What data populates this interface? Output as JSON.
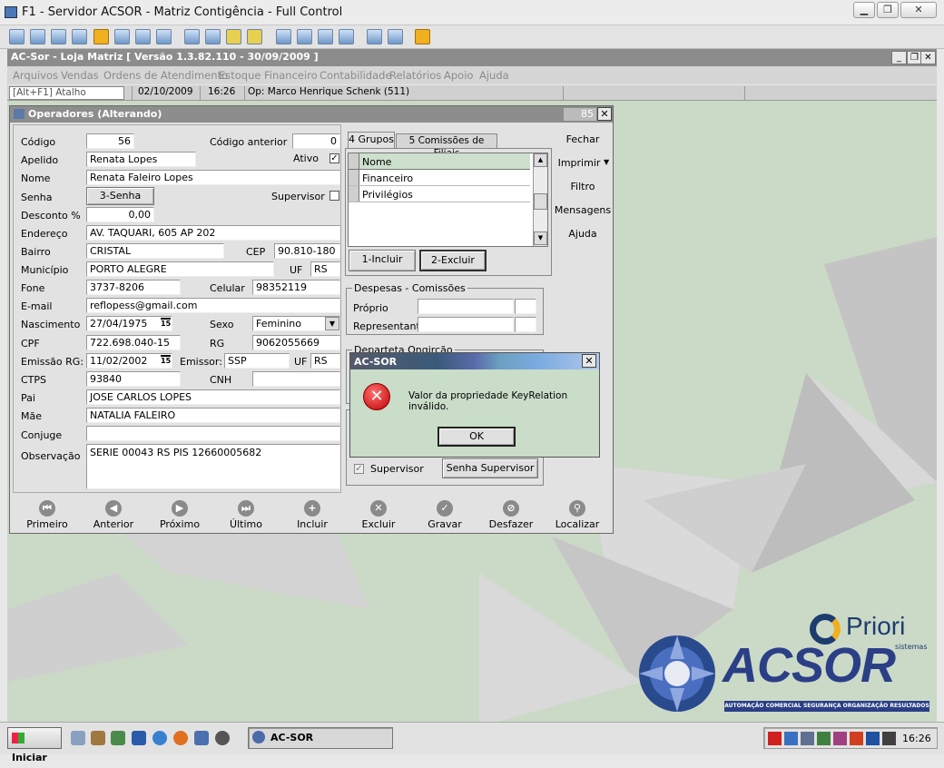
{
  "window": {
    "title": "F1 - Servidor ACSOR - Matriz Contigência - Full Control"
  },
  "app": {
    "title": "AC-Sor - Loja Matriz  [ Versão 1.3.82.110 - 30/09/2009 ]"
  },
  "menu": [
    "Arquivos",
    "Vendas",
    "Ordens de Atendimento",
    "Estoque",
    "Financeiro",
    "Contabilidade",
    "Relatórios",
    "Apoio",
    "Ajuda"
  ],
  "status": {
    "shortcut": "[Alt+F1] Atalho",
    "date": "02/10/2009",
    "time": "16:26",
    "operator": "Op: Marco Henrique Schenk (511)"
  },
  "dialog": {
    "title": "Operadores (Alterando)",
    "counter": "85",
    "fields": {
      "codigo_label": "Código",
      "codigo": "56",
      "codigo_anterior_label": "Código anterior",
      "codigo_anterior": "0",
      "apelido_label": "Apelido",
      "apelido": "Renata Lopes",
      "ativo_label": "Ativo",
      "ativo_check": "✓",
      "nome_label": "Nome",
      "nome": "Renata Faleiro Lopes",
      "senha_label": "Senha",
      "senha_button": "3-Senha",
      "supervisor_label": "Supervisor",
      "desconto_label": "Desconto %",
      "desconto": "0,00",
      "endereco_label": "Endereço",
      "endereco": "AV. TAQUARI, 605 AP 202",
      "bairro_label": "Bairro",
      "bairro": "CRISTAL",
      "cep_label": "CEP",
      "cep": "90.810-180",
      "municipio_label": "Município",
      "municipio": "PORTO ALEGRE",
      "uf_label": "UF",
      "uf": "RS",
      "fone_label": "Fone",
      "fone": "3737-8206",
      "celular_label": "Celular",
      "celular": "98352119",
      "email_label": "E-mail",
      "email": "reflopess@gmail.com",
      "nascimento_label": "Nascimento",
      "nascimento": "27/04/1975",
      "sexo_label": "Sexo",
      "sexo": "Feminino",
      "cpf_label": "CPF",
      "cpf": "722.698.040-15",
      "rg_label": "RG",
      "rg": "9062055669",
      "emissao_label": "Emissão RG:",
      "emissao": "11/02/2002",
      "emissor_label": "Emissor:",
      "emissor": "SSP",
      "uf2_label": "UF",
      "uf2": "RS",
      "ctps_label": "CTPS",
      "ctps": "93840",
      "cnh_label": "CNH",
      "pai_label": "Pai",
      "pai": "JOSE CARLOS LOPES",
      "mae_label": "Mãe",
      "mae": "NATALIA FALEIRO",
      "conjuge_label": "Conjuge",
      "observacao_label": "Observação",
      "observacao": "SERIE 00043 RS PIS 12660005682",
      "cal_icon": "15"
    },
    "tabs": [
      "4 Grupos",
      "5 Comissões de Filiais"
    ],
    "grid": {
      "header": "Nome",
      "rows": [
        "Financeiro",
        "Privilégios"
      ]
    },
    "incluir": "1-Incluir",
    "excluir": "2-Excluir",
    "despesas": {
      "title": "Despesas - Comissões",
      "proprio": "Próprio",
      "representante": "Representante"
    },
    "partial_group": "Departeta Ongirção",
    "supervisor_check_label": "Supervisor",
    "senha_supervisor": "Senha Supervisor",
    "side": {
      "fechar": "Fechar",
      "imprimir": "Imprimir",
      "filtro": "Filtro",
      "mensagens": "Mensagens",
      "ajuda": "Ajuda"
    },
    "nav": [
      "Primeiro",
      "Anterior",
      "Próximo",
      "Último",
      "Incluir",
      "Excluir",
      "Gravar",
      "Desfazer",
      "Localizar"
    ]
  },
  "error": {
    "title": "AC-SOR",
    "message": "Valor da propriedade KeyRelation inválido.",
    "ok": "OK"
  },
  "logo": {
    "priori": "Priori",
    "sistemas": "sistemas",
    "acsor": "ACSOR",
    "tagline": "AUTOMAÇÃO  COMERCIAL  SEGURANÇA  ORGANIZAÇÃO  RESULTADOS"
  },
  "taskbar": {
    "start": "Iniciar",
    "task": "AC-SOR",
    "clock": "16:26"
  }
}
